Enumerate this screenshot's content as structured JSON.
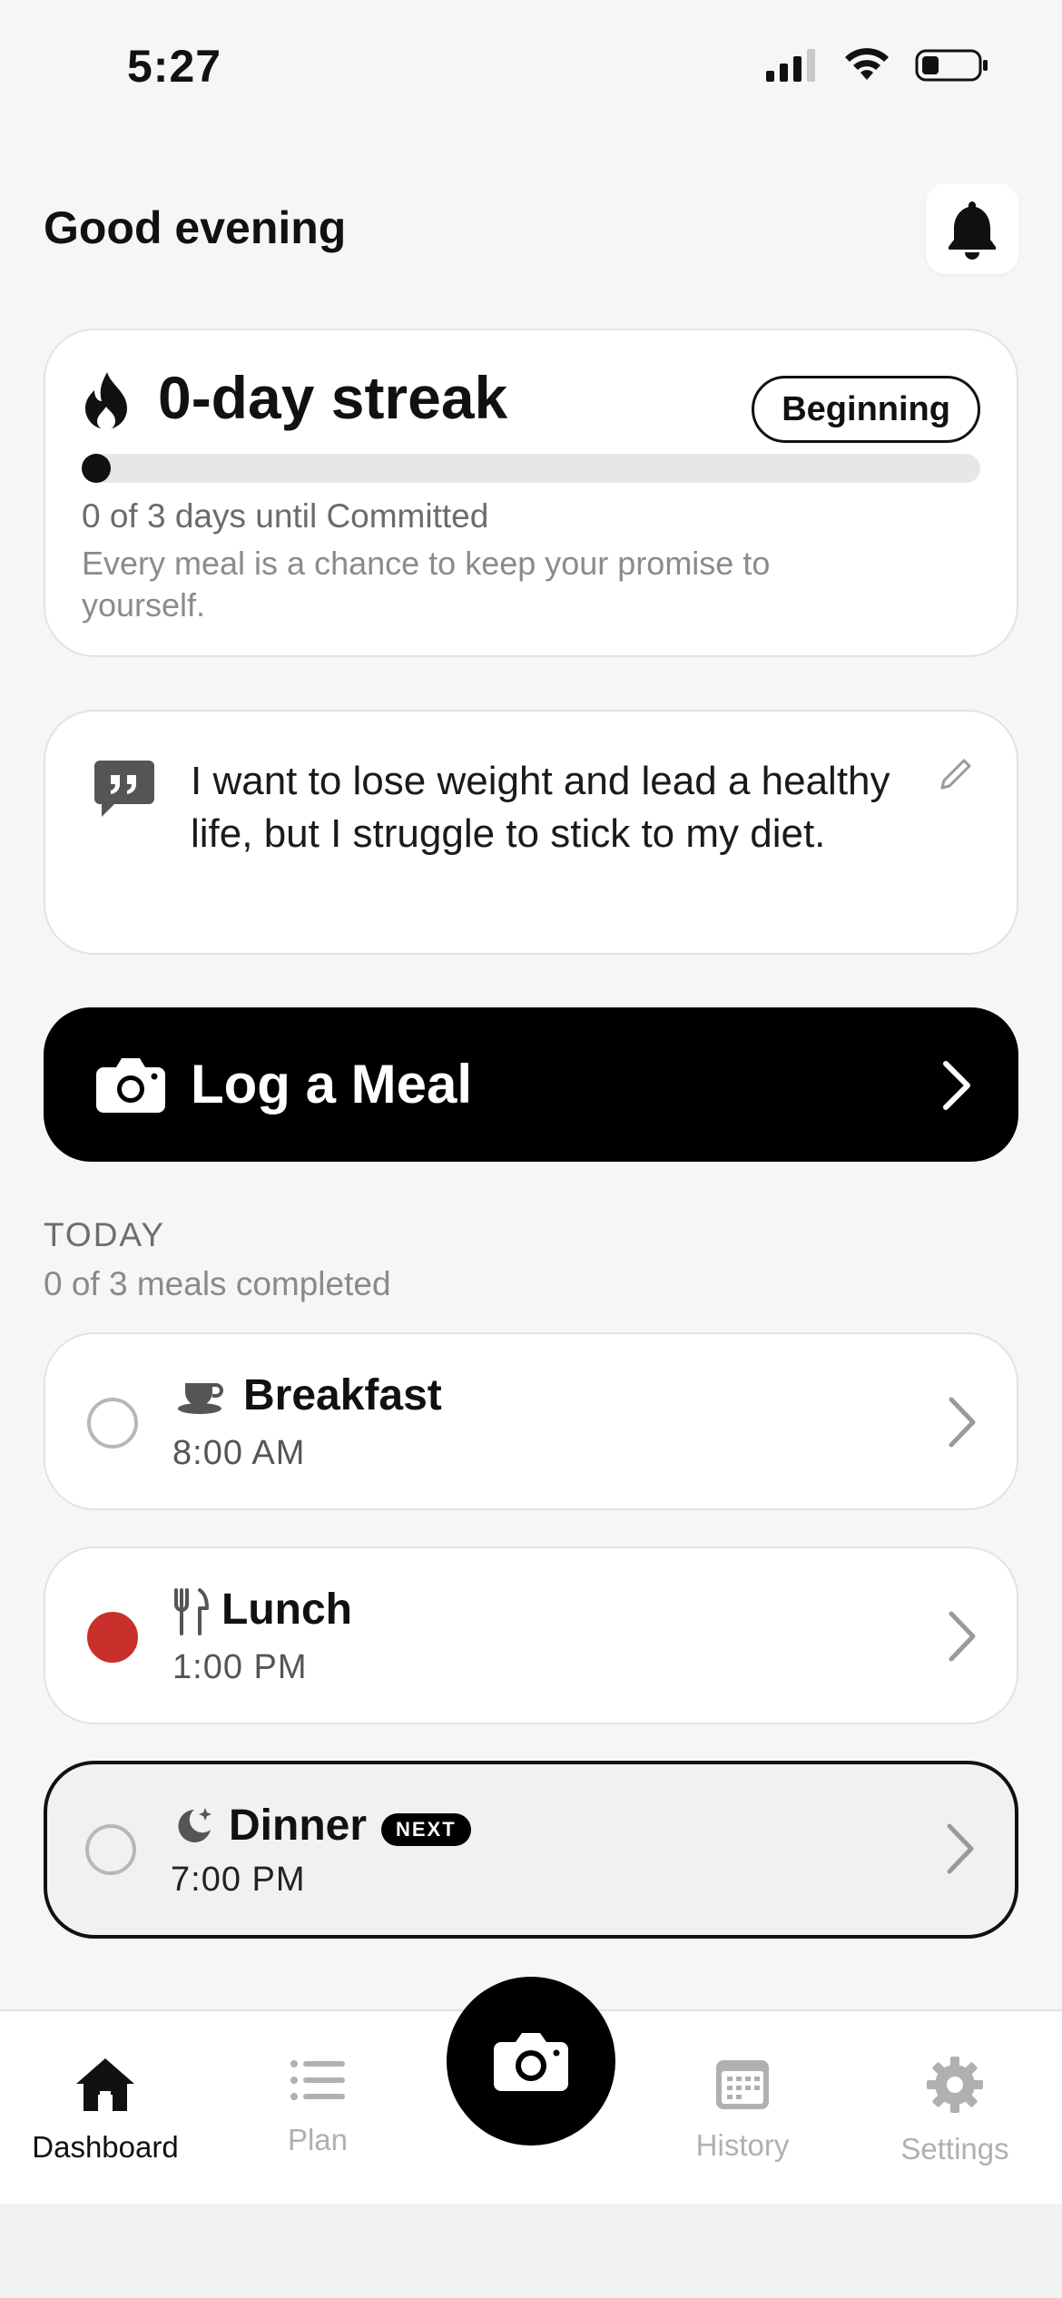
{
  "status_bar": {
    "time": "5:27"
  },
  "header": {
    "greeting": "Good evening"
  },
  "streak": {
    "title": "0-day streak",
    "stage_badge": "Beginning",
    "progress": 0.0,
    "progress_text": "0 of 3 days until Committed",
    "message": "Every meal is a chance to keep your promise to yourself."
  },
  "motivation": {
    "text": "I want to lose weight and lead a healthy life, but I struggle to stick to my diet."
  },
  "log_meal": {
    "label": "Log a Meal"
  },
  "today": {
    "title": "TODAY",
    "subtitle": "0 of 3 meals completed",
    "meals": [
      {
        "name": "Breakfast",
        "time": "8:00 AM",
        "status": "pending",
        "icon": "cup-icon"
      },
      {
        "name": "Lunch",
        "time": "1:00 PM",
        "status": "missed",
        "icon": "utensils-icon"
      },
      {
        "name": "Dinner",
        "time": "7:00 PM",
        "status": "pending",
        "icon": "moon-icon",
        "badge": "NEXT"
      }
    ]
  },
  "tabbar": {
    "tabs": [
      {
        "label": "Dashboard",
        "icon": "home-icon",
        "active": true
      },
      {
        "label": "Plan",
        "icon": "list-icon",
        "active": false
      },
      {
        "label": "History",
        "icon": "calendar-icon",
        "active": false
      },
      {
        "label": "Settings",
        "icon": "gear-icon",
        "active": false
      }
    ],
    "center_action_icon": "camera-icon"
  },
  "colors": {
    "accent": "#000000",
    "missed": "#c9302c",
    "muted": "#8b8b8b",
    "background": "#f6f6f6"
  }
}
